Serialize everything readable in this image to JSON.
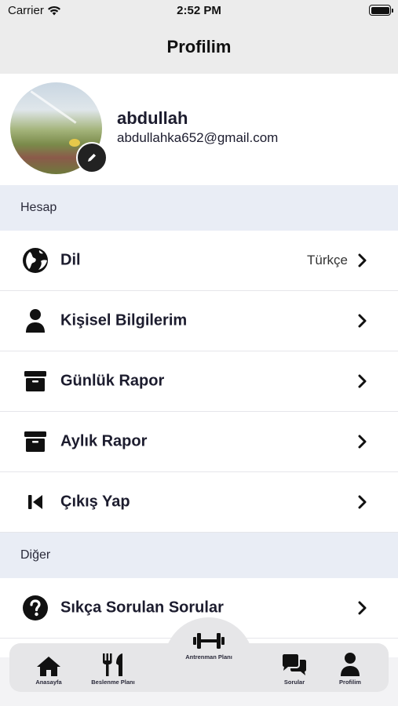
{
  "status_bar": {
    "carrier": "Carrier",
    "time": "2:52 PM"
  },
  "header": {
    "title": "Profilim"
  },
  "profile": {
    "name": "abdullah",
    "email": "abdullahka652@gmail.com"
  },
  "sections": {
    "account": {
      "label": "Hesap",
      "items": [
        {
          "label": "Dil",
          "value": "Türkçe",
          "icon": "globe-icon"
        },
        {
          "label": "Kişisel Bilgilerim",
          "icon": "user-icon"
        },
        {
          "label": "Günlük Rapor",
          "icon": "archive-icon"
        },
        {
          "label": "Aylık Rapor",
          "icon": "archive-icon"
        },
        {
          "label": "Çıkış Yap",
          "icon": "step-backward-icon"
        }
      ]
    },
    "other": {
      "label": "Diğer",
      "items": [
        {
          "label": "Sıkça Sorulan Sorular",
          "icon": "question-circle-icon"
        }
      ]
    }
  },
  "tabbar": {
    "tabs": [
      {
        "label": "Anasayfa",
        "icon": "home-icon"
      },
      {
        "label": "Beslenme Planı",
        "icon": "utensils-icon"
      },
      {
        "label": "Antrenman Planı",
        "icon": "dumbbell-icon"
      },
      {
        "label": "Sorular",
        "icon": "chat-bubbles-icon"
      },
      {
        "label": "Profilim",
        "icon": "user-icon"
      }
    ]
  },
  "colors": {
    "accent": "#1c1c2e",
    "section_bg": "#e9edf5",
    "header_bg": "#ececec",
    "tabbar_bg": "#e6e6e8"
  }
}
